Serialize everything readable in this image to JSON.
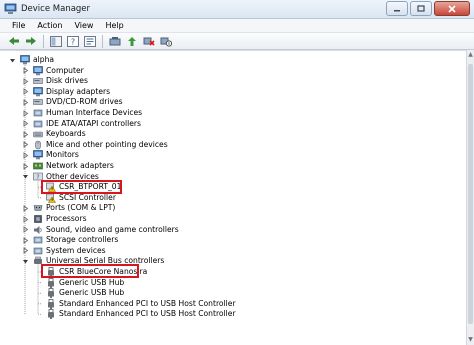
{
  "window": {
    "title": "Device Manager"
  },
  "menu": [
    "File",
    "Action",
    "View",
    "Help"
  ],
  "toolbar": [
    "back-icon",
    "forward-icon",
    "console-tree-icon",
    "help-icon",
    "properties-icon",
    "scan-hardware-icon",
    "update-driver-icon",
    "uninstall-icon",
    "disable-icon"
  ],
  "tree": {
    "root": "alpha",
    "nodes": [
      {
        "label": "Computer",
        "icon": "computer-icon"
      },
      {
        "label": "Disk drives",
        "icon": "disk-drive-icon"
      },
      {
        "label": "Display adapters",
        "icon": "display-adapter-icon"
      },
      {
        "label": "DVD/CD-ROM drives",
        "icon": "dvd-drive-icon"
      },
      {
        "label": "Human Interface Devices",
        "icon": "hid-icon"
      },
      {
        "label": "IDE ATA/ATAPI controllers",
        "icon": "ide-controller-icon"
      },
      {
        "label": "Keyboards",
        "icon": "keyboard-icon"
      },
      {
        "label": "Mice and other pointing devices",
        "icon": "mouse-icon"
      },
      {
        "label": "Monitors",
        "icon": "monitor-icon"
      },
      {
        "label": "Network adapters",
        "icon": "network-adapter-icon"
      },
      {
        "label": "Other devices",
        "icon": "other-devices-icon"
      },
      {
        "label": "CSR_BTPORT_01",
        "icon": "unknown-device-warning-icon"
      },
      {
        "label": "SCSI Controller",
        "icon": "unknown-device-warning-icon"
      },
      {
        "label": "Ports (COM & LPT)",
        "icon": "port-icon"
      },
      {
        "label": "Processors",
        "icon": "processor-icon"
      },
      {
        "label": "Sound, video and game controllers",
        "icon": "sound-icon"
      },
      {
        "label": "Storage controllers",
        "icon": "storage-controller-icon"
      },
      {
        "label": "System devices",
        "icon": "system-devices-icon"
      },
      {
        "label": "Universal Serial Bus controllers",
        "icon": "usb-controller-icon"
      },
      {
        "label": "CSR BlueCore Nanosira",
        "icon": "usb-device-icon"
      },
      {
        "label": "Generic USB Hub",
        "icon": "usb-device-icon"
      },
      {
        "label": "Generic USB Hub",
        "icon": "usb-device-icon"
      },
      {
        "label": "Standard Enhanced PCI to USB Host Controller",
        "icon": "usb-device-icon"
      },
      {
        "label": "Standard Enhanced PCI to USB Host Controller",
        "icon": "usb-device-icon"
      }
    ]
  },
  "colors": {
    "highlight": "#d9151f",
    "tree_line": "#a0a0a0"
  }
}
